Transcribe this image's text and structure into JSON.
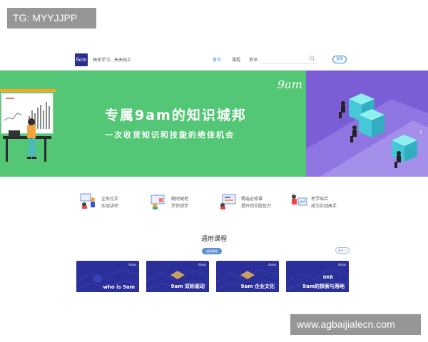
{
  "watermarks": {
    "top_left": "TG: MYYJJPP",
    "bottom_right": "www.agbaijialecn.com"
  },
  "header": {
    "logo_text": "9am",
    "slogan": "快乐学习、天天向上",
    "nav": [
      "首页",
      "课程",
      "资讯"
    ],
    "active_nav": "首页",
    "search_placeholder": "",
    "search_icon": "search-icon",
    "login_label": "登录"
  },
  "banner": {
    "brand": "9am",
    "title": "专属9am的知识城邦",
    "subtitle": "一次收货知识和技能的绝佳机会",
    "slide_count": 3,
    "active_slide": 2,
    "next_icon": "chevron-right-icon",
    "colors": {
      "left": "#53c775",
      "right": "#7b5ed6",
      "cube": "#5ad6d6"
    }
  },
  "features": [
    {
      "icon": "mentor-icon",
      "line1": "企务扎实",
      "line2": "实战讲师"
    },
    {
      "icon": "anytime-learning-icon",
      "line1": "随时随地",
      "line2": "学你想学"
    },
    {
      "icon": "course-selection-icon",
      "line1": "精选必修课",
      "line2": "提升岗位胜任力"
    },
    {
      "icon": "practice-icon",
      "line1": "考学结合",
      "line2": "成为实战高手"
    }
  ],
  "courses": {
    "section_title": "通用课程",
    "tab": "通用课程",
    "more_label": "更多 >",
    "cards": [
      {
        "top": "",
        "label": "who is 9am"
      },
      {
        "top": "",
        "label": "9am 双轮驱动"
      },
      {
        "top": "",
        "label": "9am 企业文化"
      },
      {
        "top": "OKR",
        "label": "9am的探索与落地"
      }
    ],
    "card_brand": "9am"
  }
}
